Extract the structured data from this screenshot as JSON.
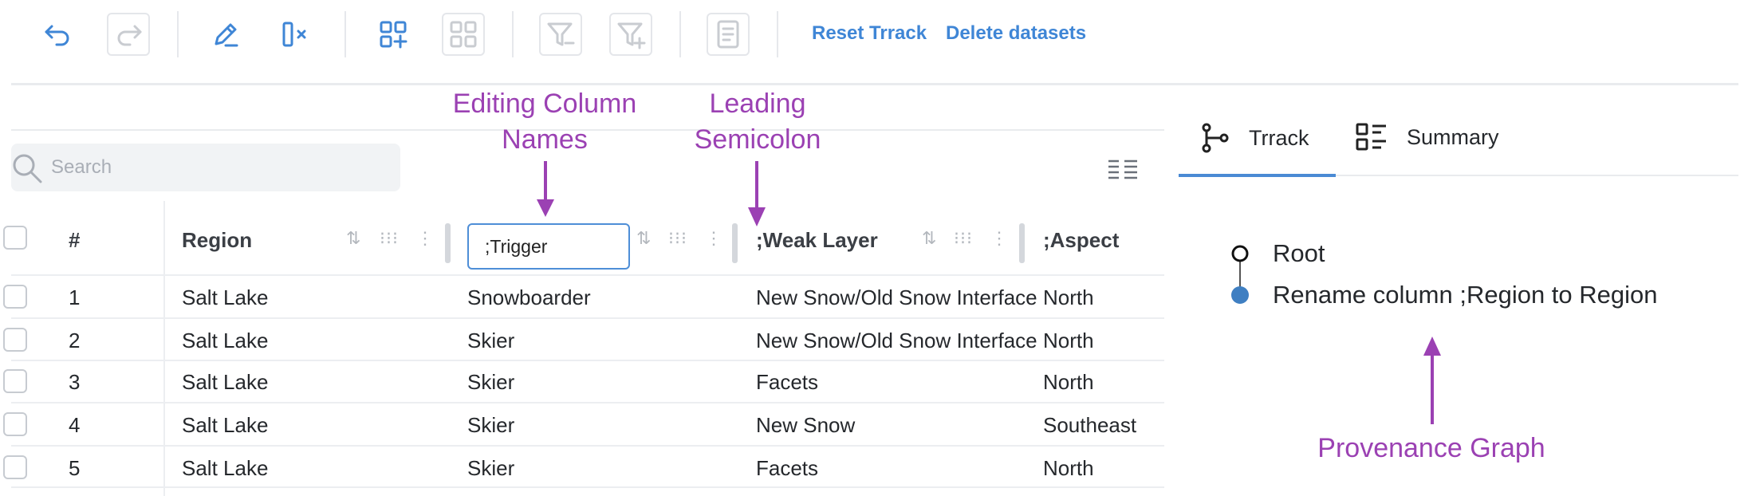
{
  "toolbar": {
    "reset_label": "Reset Trrack",
    "delete_label": "Delete datasets"
  },
  "annotations": {
    "editing": "Editing Column\nNames",
    "leading": "Leading\nSemicolon",
    "provenance": "Provenance Graph"
  },
  "search": {
    "placeholder": "Search"
  },
  "table": {
    "headers": {
      "index": "#",
      "region": "Region",
      "trigger": ";Trigger",
      "weak_layer": ";Weak Layer",
      "aspect": ";Aspect"
    },
    "rows": [
      {
        "index": "1",
        "region": "Salt Lake",
        "trigger": "Snowboarder",
        "weak_layer": "New Snow/Old Snow Interface",
        "aspect": "North"
      },
      {
        "index": "2",
        "region": "Salt Lake",
        "trigger": "Skier",
        "weak_layer": "New Snow/Old Snow Interface",
        "aspect": "North"
      },
      {
        "index": "3",
        "region": "Salt Lake",
        "trigger": "Skier",
        "weak_layer": "Facets",
        "aspect": "North"
      },
      {
        "index": "4",
        "region": "Salt Lake",
        "trigger": "Skier",
        "weak_layer": "New Snow",
        "aspect": "Southeast"
      },
      {
        "index": "5",
        "region": "Salt Lake",
        "trigger": "Skier",
        "weak_layer": "Facets",
        "aspect": "North"
      }
    ]
  },
  "panel": {
    "tabs": [
      {
        "label": "Trrack"
      },
      {
        "label": "Summary"
      }
    ],
    "provenance": [
      {
        "label": "Root"
      },
      {
        "label": "Rename column ;Region to Region"
      }
    ]
  },
  "colors": {
    "accent": "#3f86d6",
    "annotation": "#9b41b3",
    "provenance_node": "#3f7fc2"
  }
}
